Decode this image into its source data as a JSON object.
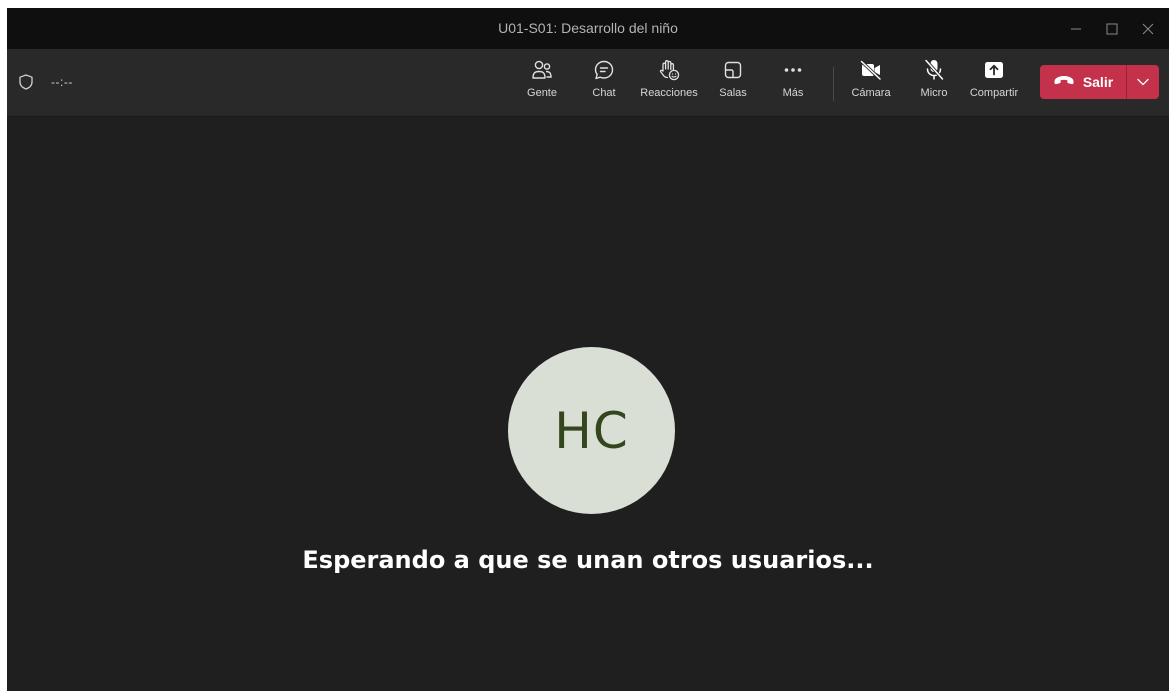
{
  "window": {
    "title": "U01-S01: Desarrollo del niño"
  },
  "toolbar": {
    "timer": "--:--",
    "buttons": [
      {
        "label": "Gente",
        "icon": "people-icon"
      },
      {
        "label": "Chat",
        "icon": "chat-icon"
      },
      {
        "label": "Reacciones",
        "icon": "raise-hand-icon"
      },
      {
        "label": "Salas",
        "icon": "rooms-icon"
      },
      {
        "label": "Más",
        "icon": "more-icon"
      },
      {
        "label": "Cámara",
        "icon": "camera-off-icon"
      },
      {
        "label": "Micro",
        "icon": "mic-off-icon"
      },
      {
        "label": "Compartir",
        "icon": "share-icon"
      }
    ],
    "leave_label": "Salir"
  },
  "stage": {
    "avatar_initials": "HC",
    "waiting_text": "Esperando a que se unan otros usuarios..."
  },
  "colors": {
    "background": "#1f1f1f",
    "titlebar": "#0f0f0f",
    "toolbar": "#292929",
    "leave_button": "#c4314b",
    "avatar_bg": "#d9dfd4",
    "avatar_text": "#33461e"
  }
}
